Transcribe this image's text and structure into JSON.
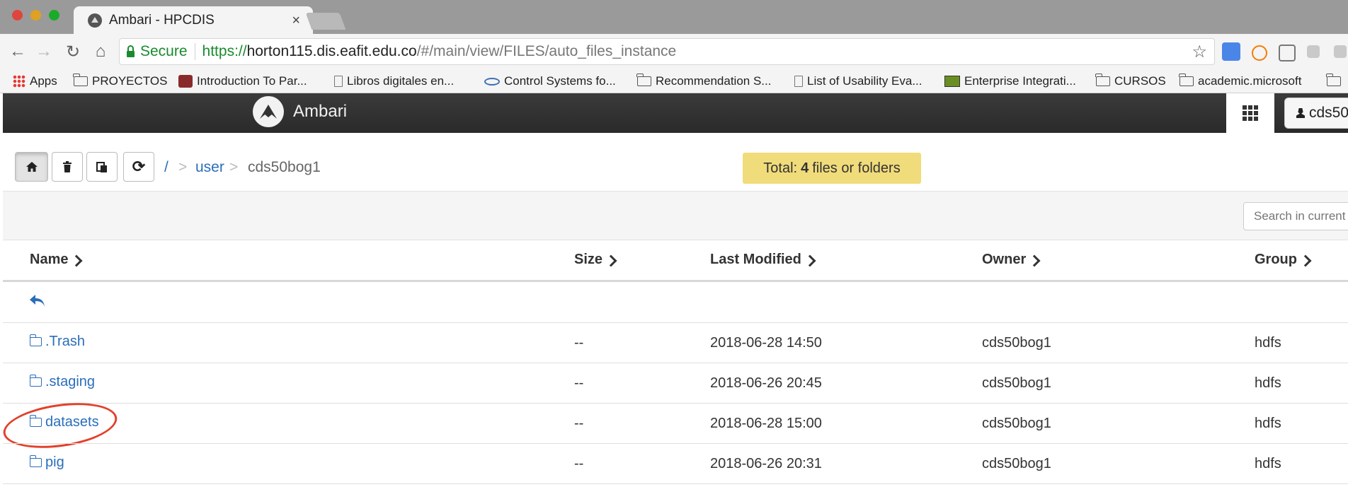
{
  "browser": {
    "tab_title": "Ambari - HPCDIS",
    "tab_close": "×",
    "secure_label": "Secure",
    "url_scheme": "https://",
    "url_host": "horton115.dis.eafit.edu.co",
    "url_path": "/#/main/view/FILES/auto_files_instance",
    "nav_icons": [
      "back-icon",
      "forward-icon",
      "reload-icon",
      "home-icon"
    ],
    "bookmarks": [
      {
        "label": "Apps",
        "icon": "apps-icon"
      },
      {
        "label": "PROYECTOS",
        "icon": "folder-icon"
      },
      {
        "label": "Introduction To Par...",
        "icon": "crest-icon"
      },
      {
        "label": "Libros digitales en...",
        "icon": "page-icon"
      },
      {
        "label": "Control Systems fo...",
        "icon": "eye-icon"
      },
      {
        "label": "Recommendation S...",
        "icon": "folder-icon"
      },
      {
        "label": "List of Usability Eva...",
        "icon": "page-icon"
      },
      {
        "label": "Enterprise Integrati...",
        "icon": "green-icon"
      },
      {
        "label": "CURSOS",
        "icon": "folder-icon"
      },
      {
        "label": "academic.microsoft",
        "icon": "folder-icon"
      }
    ]
  },
  "app": {
    "name": "Ambari",
    "user": "cds50"
  },
  "toolbar": {
    "breadcrumb_root": "/",
    "breadcrumb_sep": ">",
    "breadcrumb_user": "user",
    "breadcrumb_current": "cds50bog1",
    "total_prefix": "Total:",
    "total_count": "4",
    "total_suffix": "files or folders"
  },
  "search": {
    "placeholder": "Search in current"
  },
  "table": {
    "headers": {
      "name": "Name",
      "size": "Size",
      "modified": "Last Modified",
      "owner": "Owner",
      "group": "Group"
    },
    "rows": [
      {
        "name": ".Trash",
        "size": "--",
        "modified": "2018-06-28 14:50",
        "owner": "cds50bog1",
        "group": "hdfs"
      },
      {
        "name": ".staging",
        "size": "--",
        "modified": "2018-06-26 20:45",
        "owner": "cds50bog1",
        "group": "hdfs"
      },
      {
        "name": "datasets",
        "size": "--",
        "modified": "2018-06-28 15:00",
        "owner": "cds50bog1",
        "group": "hdfs"
      },
      {
        "name": "pig",
        "size": "--",
        "modified": "2018-06-26 20:31",
        "owner": "cds50bog1",
        "group": "hdfs"
      }
    ]
  },
  "colors": {
    "link": "#2a6ebb",
    "badge": "#f0dc7a",
    "annotation": "#e2412a",
    "header_bg": "#333333"
  }
}
